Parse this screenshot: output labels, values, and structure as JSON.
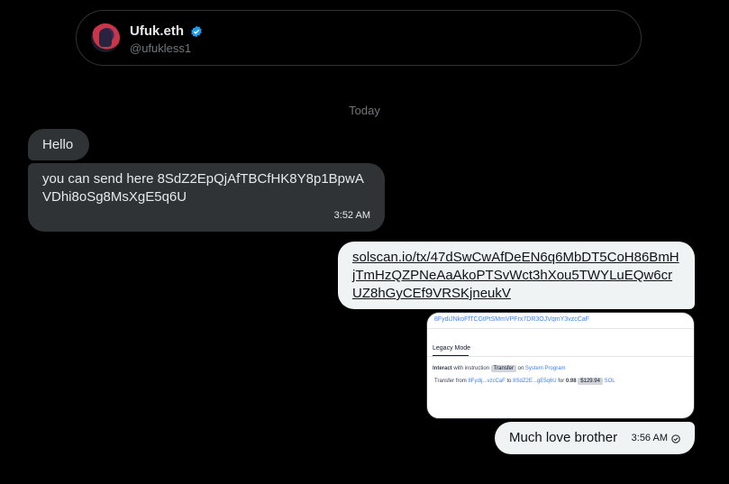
{
  "profile": {
    "display_name": "Ufuk.eth",
    "handle": "@ufukless1",
    "verified_icon": "verified-badge-icon",
    "verified_color": "#1d9bf0"
  },
  "conversation": {
    "date_separator": "Today",
    "messages": [
      {
        "direction": "incoming",
        "text": "Hello"
      },
      {
        "direction": "incoming",
        "text": "you can send here 8SdZ2EpQjAfTBCfHK8Y8p1BpwAVDhi8oSg8MsXgE5q6U",
        "time": "3:52 AM"
      },
      {
        "direction": "outgoing",
        "link": "solscan.io/tx/47dSwCwAfDeEN6q6MbDT5CoH86BmHjTmHzQZPNeAaAkoPTSvWct3hXou5TWYLuEQw6crUZ8hGyCEf9VRSKjneukV"
      },
      {
        "direction": "outgoing",
        "text": "Much love brother",
        "time": "3:56 AM",
        "status_icon": "read-check-icon"
      }
    ],
    "attachment": {
      "top_address": "8FydiJNkoFfTCGtPtSMmVPFrx7DR3OJVqmY3vzcCaF",
      "tab_label": "Legacy Mode",
      "row1": {
        "prefix": "Interact",
        "middle": "with instruction",
        "pill": "Transfer",
        "on": "on",
        "program": "System Program"
      },
      "row2": {
        "label": "Transfer from",
        "from": "8Fydij...vzcCaF",
        "to_label": "to",
        "to": "8SdZ2E...gE5q6U",
        "for_label": "for",
        "amount": "0.98",
        "usd": "$129.94",
        "token": "SOL"
      }
    }
  },
  "colors": {
    "background": "#000000",
    "incoming_bubble": "#2f3336",
    "outgoing_bubble": "#eff3f4",
    "muted_text": "#71767b"
  }
}
